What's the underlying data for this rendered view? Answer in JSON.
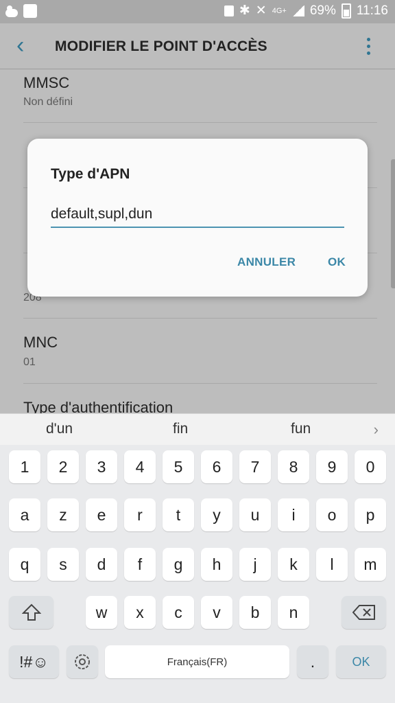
{
  "statusbar": {
    "battery": "69%",
    "time": "11:16",
    "network": "4G+"
  },
  "appbar": {
    "title": "MODIFIER LE POINT D'ACCÈS"
  },
  "list": [
    {
      "title": "MMSC",
      "sub": "Non défini"
    },
    {
      "title": "",
      "sub": ""
    },
    {
      "title": "",
      "sub": ""
    },
    {
      "title": "",
      "sub": "208"
    },
    {
      "title": "MNC",
      "sub": "01"
    },
    {
      "title": "Type d'authentification",
      "sub": ""
    }
  ],
  "dialog": {
    "title": "Type d'APN",
    "value": "default,supl,dun",
    "cancel": "ANNULER",
    "ok": "OK"
  },
  "suggestions": [
    "d'un",
    "fin",
    "fun"
  ],
  "keyboard": {
    "row1": [
      "1",
      "2",
      "3",
      "4",
      "5",
      "6",
      "7",
      "8",
      "9",
      "0"
    ],
    "row2": [
      "a",
      "z",
      "e",
      "r",
      "t",
      "y",
      "u",
      "i",
      "o",
      "p"
    ],
    "row3": [
      "q",
      "s",
      "d",
      "f",
      "g",
      "h",
      "j",
      "k",
      "l",
      "m"
    ],
    "row4": [
      "w",
      "x",
      "c",
      "v",
      "b",
      "n"
    ],
    "symbols": "!#☺",
    "space": "Français(FR)",
    "period": ".",
    "ok": "OK"
  },
  "icons": {
    "back": "back-arrow-icon",
    "more": "more-vert-icon",
    "shift": "shift-icon",
    "backspace": "backspace-icon",
    "settings": "gear-icon"
  }
}
